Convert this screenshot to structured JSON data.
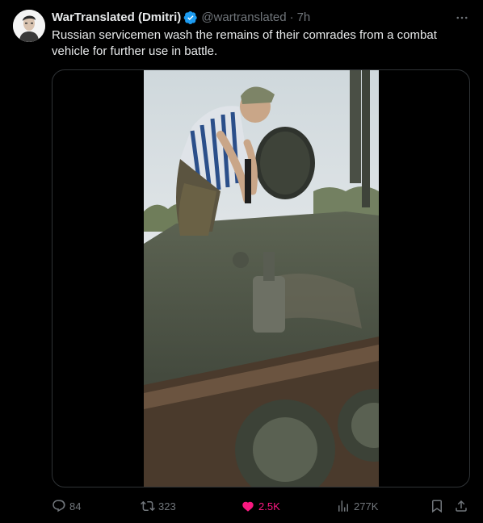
{
  "tweet": {
    "display_name": "WarTranslated (Dmitri)",
    "handle": "@wartranslated",
    "separator": "·",
    "time": "7h",
    "text": "Russian servicemen wash the remains of their comrades from a combat vehicle for further use in battle.",
    "verified_icon": "verified-badge-icon",
    "more_icon": "more-icon"
  },
  "media": {
    "type": "video"
  },
  "actions": {
    "reply_count": "84",
    "retweet_count": "323",
    "like_count": "2.5K",
    "view_count": "277K",
    "reply_icon": "reply-icon",
    "retweet_icon": "retweet-icon",
    "like_icon": "heart-icon",
    "views_icon": "views-icon",
    "bookmark_icon": "bookmark-icon",
    "share_icon": "share-icon"
  },
  "colors": {
    "background": "#000000",
    "text": "#e7e9ea",
    "muted": "#71767b",
    "verified": "#1d9bf0",
    "like": "#f91880",
    "border": "#2f3336"
  }
}
